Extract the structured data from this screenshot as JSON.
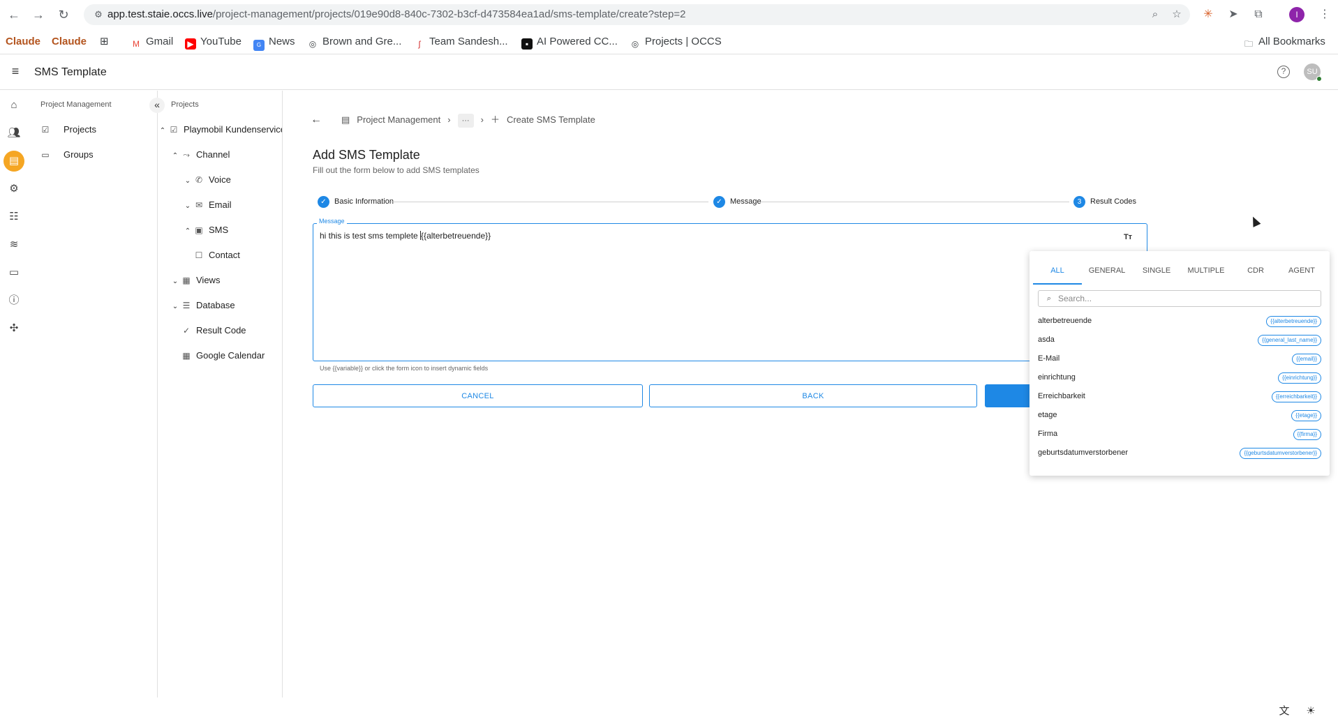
{
  "browser": {
    "url_host": "app.test.staie.occs.live",
    "url_path": "/project-management/projects/019e90d8-840c-7302-b3cf-d473584ea1ad/sms-template/create?step=2",
    "profile_initial": "I",
    "bookmarks": [
      {
        "label": "Claude",
        "icon": "claude-icon"
      },
      {
        "label": "Claude",
        "icon": "claude-icon"
      },
      {
        "label": "",
        "icon": "apps-grid-icon"
      },
      {
        "label": "Gmail",
        "icon": "gmail-icon"
      },
      {
        "label": "YouTube",
        "icon": "youtube-icon"
      },
      {
        "label": "News",
        "icon": "news-icon"
      },
      {
        "label": "Brown and Gre...",
        "icon": "globe-icon"
      },
      {
        "label": "Team Sandesh...",
        "icon": "sandesh-icon"
      },
      {
        "label": "AI Powered CC...",
        "icon": "ai-icon"
      },
      {
        "label": "Projects | OCCS",
        "icon": "globe-icon"
      }
    ],
    "all_bookmarks": "All Bookmarks"
  },
  "app": {
    "title": "SMS Template",
    "avatar_initials": "SU"
  },
  "pm_panel": {
    "title": "Project Management",
    "items": [
      "Projects",
      "Groups"
    ]
  },
  "tree": {
    "title": "Projects",
    "items": [
      {
        "label": "Playmobil Kundenservice",
        "icon": "checkbox-icon",
        "chevron": "up"
      },
      {
        "label": "Channel",
        "icon": "channel-icon",
        "chevron": "up"
      },
      {
        "label": "Voice",
        "icon": "phone-icon",
        "chevron": "down"
      },
      {
        "label": "Email",
        "icon": "mail-icon",
        "chevron": "down"
      },
      {
        "label": "SMS",
        "icon": "sms-icon",
        "chevron": "up"
      },
      {
        "label": "Contact",
        "icon": "contact-icon",
        "chevron": ""
      },
      {
        "label": "Views",
        "icon": "views-icon",
        "chevron": "down"
      },
      {
        "label": "Database",
        "icon": "database-icon",
        "chevron": "down"
      },
      {
        "label": "Result Code",
        "icon": "check-icon",
        "chevron": ""
      },
      {
        "label": "Google Calendar",
        "icon": "calendar-icon",
        "chevron": ""
      }
    ]
  },
  "breadcrumb": {
    "root": "Project Management",
    "ellipsis": "···",
    "current": "Create SMS Template"
  },
  "page": {
    "title": "Add SMS Template",
    "subtitle": "Fill out the form below to add SMS templates"
  },
  "stepper": {
    "steps": [
      {
        "label": "Basic Information",
        "state": "done"
      },
      {
        "label": "Message",
        "state": "done"
      },
      {
        "label": "Result Codes",
        "state": "active",
        "number": "3"
      }
    ]
  },
  "message": {
    "label": "Message",
    "value_before": "hi this is test sms templete ",
    "value_after": "{{alterbetreuende}}",
    "helper": "Use {{variable}} or click the form icon to insert dynamic fields"
  },
  "buttons": {
    "cancel": "CANCEL",
    "back": "BACK"
  },
  "variables": {
    "tabs": [
      "ALL",
      "GENERAL",
      "SINGLE",
      "MULTIPLE",
      "CDR",
      "AGENT"
    ],
    "active_tab": "ALL",
    "search_placeholder": "Search...",
    "items": [
      {
        "name": "alterbetreuende",
        "token": "{{alterbetreuende}}"
      },
      {
        "name": "asda",
        "token": "{{general_last_name}}"
      },
      {
        "name": "E-Mail",
        "token": "{{email}}"
      },
      {
        "name": "einrichtung",
        "token": "{{einrichtung}}"
      },
      {
        "name": "Erreichbarkeit",
        "token": "{{erreichbarkeit}}"
      },
      {
        "name": "etage",
        "token": "{{etage}}"
      },
      {
        "name": "Firma",
        "token": "{{firma}}"
      },
      {
        "name": "geburtsdatumverstorbener",
        "token": "{{geburtsdatumverstorbener}}"
      }
    ]
  },
  "colors": {
    "accent": "#1e88e5",
    "rail_active": "#f5a623"
  }
}
